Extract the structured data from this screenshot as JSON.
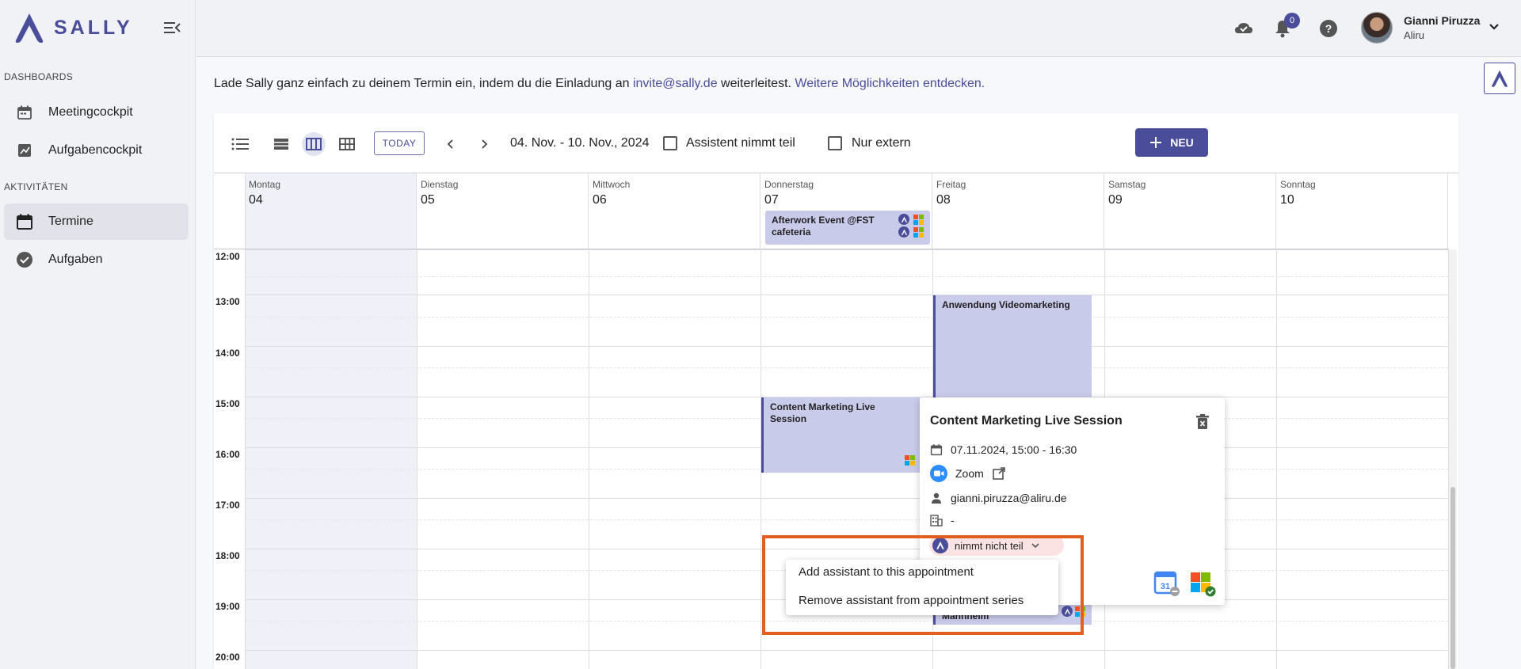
{
  "app": {
    "name": "SALLY"
  },
  "sidebar": {
    "sections": [
      {
        "title": "DASHBOARDS",
        "items": [
          {
            "label": "Meetingcockpit",
            "icon": "calendar-icon"
          },
          {
            "label": "Aufgabencockpit",
            "icon": "chart-icon"
          }
        ]
      },
      {
        "title": "AKTIVITÄTEN",
        "items": [
          {
            "label": "Termine",
            "icon": "calendar-icon",
            "active": true
          },
          {
            "label": "Aufgaben",
            "icon": "check-circle-icon"
          }
        ]
      }
    ]
  },
  "header": {
    "notification_count": "0",
    "user": {
      "name": "Gianni Piruzza",
      "org": "Aliru"
    }
  },
  "info": {
    "text_before": "Lade Sally ganz einfach zu deinem Termin ein, indem du die Einladung an ",
    "email_link": "invite@sally.de",
    "text_middle": " weiterleitest. ",
    "more_link": "Weitere Möglichkeiten entdecken."
  },
  "toolbar": {
    "today": "TODAY",
    "date_range": "04. Nov. - 10. Nov., 2024",
    "filter_assistant": "Assistent nimmt teil",
    "filter_external": "Nur extern",
    "new": "NEU"
  },
  "days": [
    {
      "name": "Montag",
      "num": "04"
    },
    {
      "name": "Dienstag",
      "num": "05"
    },
    {
      "name": "Mittwoch",
      "num": "06"
    },
    {
      "name": "Donnerstag",
      "num": "07"
    },
    {
      "name": "Freitag",
      "num": "08"
    },
    {
      "name": "Samstag",
      "num": "09"
    },
    {
      "name": "Sonntag",
      "num": "10"
    }
  ],
  "times": [
    "12:00",
    "13:00",
    "14:00",
    "15:00",
    "16:00",
    "17:00",
    "18:00",
    "19:00",
    "20:00"
  ],
  "events": {
    "allday": "Afterwork Event @FST cafeteria",
    "video": "Anwendung Videomarketing",
    "content": "Content Marketing Live Session",
    "mannheim": "Mannheim"
  },
  "popover": {
    "title": "Content Marketing Live Session",
    "datetime": "07.11.2024, 15:00 - 16:30",
    "location": "Zoom",
    "organizer": "gianni.piruzza@aliru.de",
    "room": "-",
    "status": "nimmt nicht teil"
  },
  "dropdown": {
    "add": "Add assistant to this appointment",
    "remove": "Remove assistant from appointment series"
  },
  "colors": {
    "accent": "#4a4d99",
    "event": "#c9cbea",
    "highlight": "#e2601f",
    "status_chip": "#fbe3e3"
  }
}
